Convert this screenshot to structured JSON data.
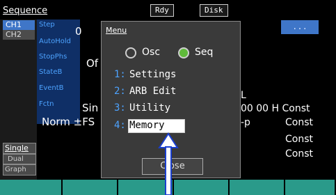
{
  "header": {
    "mode_title": "Sequence",
    "status_ready": "Rdy",
    "status_disk": "Disk"
  },
  "channels": {
    "ch1": "CH1",
    "ch2": "CH2"
  },
  "params": [
    "Step",
    "AutoHold",
    "StopPhs",
    "StateB",
    "EventB",
    "Fctn"
  ],
  "values": {
    "step": "0",
    "stop_phase_partial": "Of",
    "fctn_partial": "Sin",
    "norm_line": "Norm ±FS",
    "right_1": "L",
    "right_2": "00 00 H Const",
    "right_3": "-p",
    "right_3b": "Const",
    "right_4": "Const",
    "right_5": "Const",
    "more_button": "..."
  },
  "display_modes": {
    "single": "Single",
    "dual": "Dual",
    "graph": "Graph"
  },
  "menu": {
    "title": "Menu",
    "options": [
      {
        "label": "Osc",
        "selected": false
      },
      {
        "label": "Seq",
        "selected": true
      }
    ],
    "items": [
      {
        "num": "1:",
        "label": "Settings"
      },
      {
        "num": "2:",
        "label": "ARB Edit"
      },
      {
        "num": "3:",
        "label": "Utility"
      },
      {
        "num": "4:",
        "label": "Memory"
      }
    ],
    "close_label": "Close"
  },
  "colors": {
    "accent_blue": "#3f76c8",
    "param_text": "#4da3ff",
    "radio_on": "#5fba3a",
    "softkey": "#2a9a8a",
    "pointer_arrow": "#1a3fd0"
  }
}
